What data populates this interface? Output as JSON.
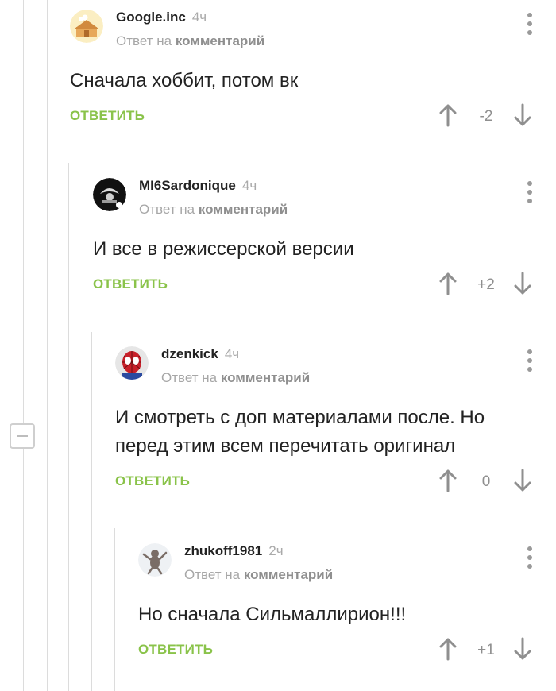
{
  "comments": [
    {
      "author": "Google.inc",
      "time": "4ч",
      "reply_prefix": "Ответ на",
      "reply_target": "комментарий",
      "text": "Сначала хоббит, потом вк",
      "reply_label": "ОТВЕТИТЬ",
      "score": "-2"
    },
    {
      "author": "MI6Sardonique",
      "time": "4ч",
      "reply_prefix": "Ответ на",
      "reply_target": "комментарий",
      "text": "И все в режиссерской версии",
      "reply_label": "ОТВЕТИТЬ",
      "score": "+2"
    },
    {
      "author": "dzenkick",
      "time": "4ч",
      "reply_prefix": "Ответ на",
      "reply_target": "комментарий",
      "text": "И смотреть с доп материалами после. Но\nперед этим всем перечитать оригинал",
      "reply_label": "ОТВЕТИТЬ",
      "score": "0"
    },
    {
      "author": "zhukoff1981",
      "time": "2ч",
      "reply_prefix": "Ответ на",
      "reply_target": "комментарий",
      "text": "Но сначала Сильмаллирион!!!",
      "reply_label": "ОТВЕТИТЬ",
      "score": "+1"
    }
  ],
  "colors": {
    "reply_accent": "#8ac34a",
    "meta": "#a7a7a7",
    "thread_line": "#dcdcdc"
  },
  "icons": [
    "collapse-icon",
    "more-vertical-icon",
    "upvote-arrow-icon",
    "downvote-arrow-icon"
  ]
}
